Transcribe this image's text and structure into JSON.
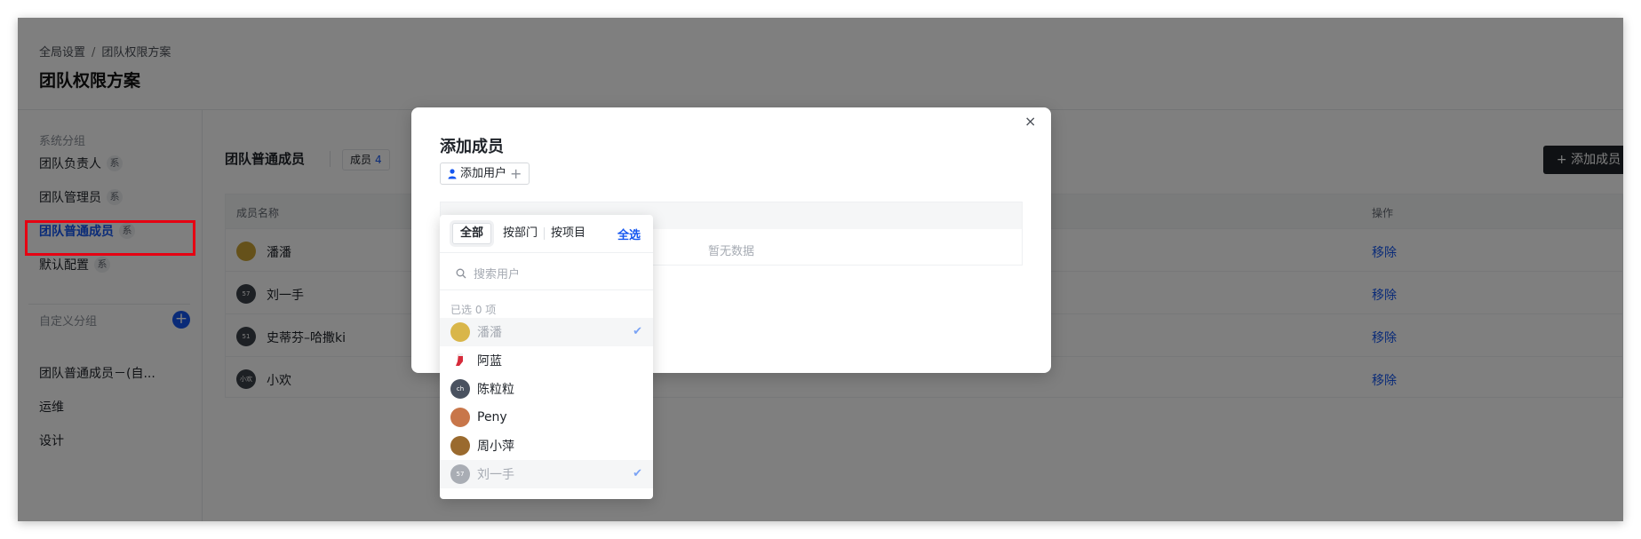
{
  "header": {
    "breadcrumb_root": "全局设置",
    "breadcrumb_sep": "/",
    "breadcrumb_current": "团队权限方案",
    "title": "团队权限方案"
  },
  "sidebar": {
    "system_label": "系统分组",
    "system_items": [
      {
        "label": "团队负责人",
        "tag": "系"
      },
      {
        "label": "团队管理员",
        "tag": "系"
      },
      {
        "label": "团队普通成员",
        "tag": "系"
      },
      {
        "label": "默认配置",
        "tag": "系"
      }
    ],
    "custom_label": "自定义分组",
    "custom_add": "+",
    "custom_items": [
      {
        "label": "团队普通成员－(自..."
      },
      {
        "label": "运维"
      },
      {
        "label": "设计"
      }
    ]
  },
  "main": {
    "title": "团队普通成员",
    "count_label": "成员",
    "count": "4",
    "add_button": "+ 添加成员",
    "col_name": "成员名称",
    "col_action": "操作",
    "rows": [
      {
        "avatar": "",
        "name": "潘潘",
        "action": "移除"
      },
      {
        "avatar": "57",
        "name": "刘一手",
        "action": "移除"
      },
      {
        "avatar": "51",
        "name": "史蒂芬–哈撒ki",
        "action": "移除"
      },
      {
        "avatar": "小欢",
        "name": "小欢",
        "action": "移除"
      }
    ]
  },
  "modal": {
    "title": "添加成员",
    "close": "×",
    "add_user": "添加用户",
    "add_user_plus": "+",
    "empty": "暂无数据"
  },
  "dropdown": {
    "tab_all": "全部",
    "tab_dept": "按部门",
    "tab_project": "按项目",
    "select_all": "全选",
    "search_placeholder": "搜索用户",
    "selected_count": "已选 0 项",
    "users": [
      {
        "avatar": "",
        "name": "潘潘",
        "selected": true
      },
      {
        "avatar": "",
        "name": "阿蓝",
        "selected": false
      },
      {
        "avatar": "ch",
        "name": "陈粒粒",
        "selected": false
      },
      {
        "avatar": "",
        "name": "Peny",
        "selected": false
      },
      {
        "avatar": "",
        "name": "周小萍",
        "selected": false
      },
      {
        "avatar": "57",
        "name": "刘一手",
        "selected": true
      }
    ]
  },
  "colors": {
    "accent": "#1456f0",
    "highlight_box": "#e60012",
    "dark_button": "#1f2329"
  }
}
